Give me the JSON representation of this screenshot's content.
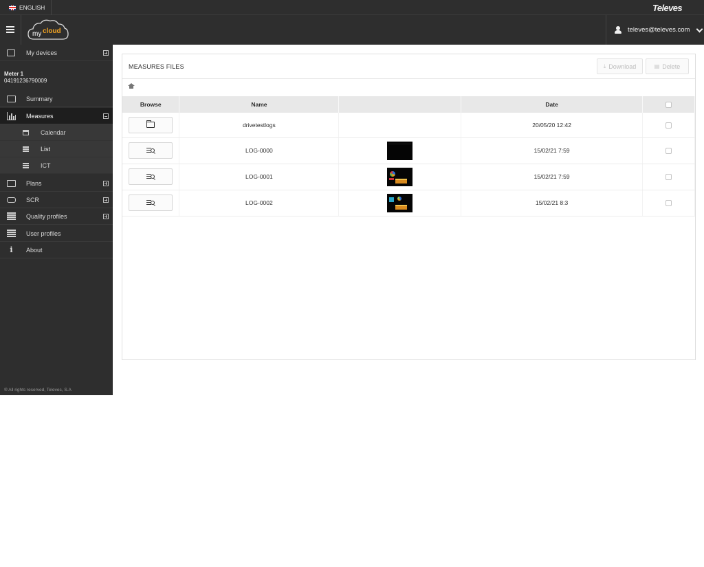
{
  "topbar": {
    "language": "ENGLISH",
    "brand": "Televes"
  },
  "header": {
    "logo_text_my": "my",
    "logo_text_cloud": "cloud",
    "user_email": "televes@televes.com"
  },
  "sidebar": {
    "my_devices": "My devices",
    "meter_name": "Meter 1",
    "meter_id": "04191236790009",
    "summary": "Summary",
    "measures": "Measures",
    "calendar": "Calendar",
    "list": "List",
    "ict": "ICT",
    "plans": "Plans",
    "scr": "SCR",
    "quality_profiles": "Quality profiles",
    "user_profiles": "User profiles",
    "about": "About",
    "copyright": "® All rights reserved, Televes, S.A"
  },
  "panel": {
    "title": "MEASURES FILES",
    "download": "Download",
    "delete": "Delete"
  },
  "table": {
    "headers": {
      "browse": "Browse",
      "name": "Name",
      "preview": "",
      "date": "Date"
    },
    "rows": [
      {
        "name": "drivetestlogs",
        "date": "20/05/20 12:42",
        "icon": "folder-icon"
      },
      {
        "name": "LOG-0000",
        "date": "15/02/21 7:59",
        "icon": "view-icon"
      },
      {
        "name": "LOG-0001",
        "date": "15/02/21 7:59",
        "icon": "view-icon"
      },
      {
        "name": "LOG-0002",
        "date": "15/02/21 8:3",
        "icon": "view-icon"
      }
    ]
  },
  "colors": {
    "dark_bar": "#2e2e2e",
    "active_nav": "#1e1e1e",
    "logo_accent": "#f5a623"
  }
}
